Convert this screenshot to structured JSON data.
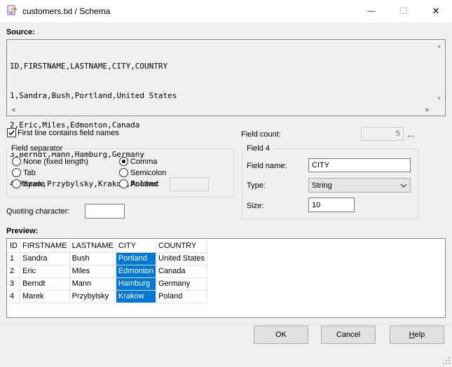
{
  "window": {
    "title": "customers.txt / Schema",
    "minimize_glyph": "—",
    "maximize_glyph": "☐",
    "close_glyph": "✕"
  },
  "source": {
    "label": "Source:",
    "lines": [
      "ID,FIRSTNAME,LASTNAME,CITY,COUNTRY",
      "1,Sandra,Bush,Portland,United States",
      "2,Eric,Miles,Edmonton,Canada",
      "3,Berndt,Mann,Hamburg,Germany",
      "4,Marek,Przybylsky,Krakow,Poland"
    ]
  },
  "first_line_names": {
    "label": "First line contains field names",
    "checked": true
  },
  "field_separator": {
    "title": "Field separator",
    "options": {
      "none": "None (fixed length)",
      "tab": "Tab",
      "space": "Space",
      "comma": "Comma",
      "semicolon": "Semicolon",
      "another": "Another:"
    },
    "selected": "comma",
    "another_value": ""
  },
  "quoting": {
    "label": "Quoting character:",
    "value": ""
  },
  "field_count": {
    "label": "Field count:",
    "value": "5",
    "more_label": "..."
  },
  "field": {
    "title": "Field 4",
    "name_label": "Field name:",
    "name_value": "CITY",
    "type_label": "Type:",
    "type_value": "String",
    "size_label": "Size:",
    "size_value": "10"
  },
  "preview": {
    "label": "Preview:",
    "columns": [
      "ID",
      "FIRSTNAME",
      "LASTNAME",
      "CITY",
      "COUNTRY"
    ],
    "rows": [
      [
        "1",
        "Sandra",
        "Bush",
        "Portland",
        "United States"
      ],
      [
        "2",
        "Eric",
        "Miles",
        "Edmonton",
        "Canada"
      ],
      [
        "3",
        "Berndt",
        "Mann",
        "Hamburg",
        "Germany"
      ],
      [
        "4",
        "Marek",
        "Przybylsky",
        "Krakow",
        "Poland"
      ]
    ],
    "highlight_column": 3,
    "highlight_color": "#0078d7"
  },
  "buttons": {
    "ok": "OK",
    "cancel": "Cancel",
    "help_prefix": "H",
    "help_rest": "elp"
  }
}
